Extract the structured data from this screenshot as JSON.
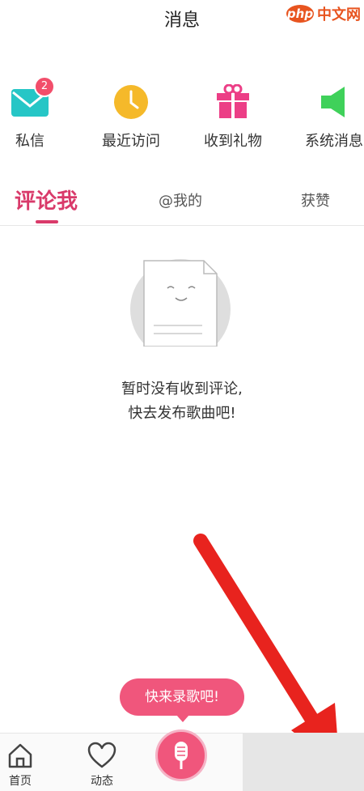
{
  "watermark": {
    "logo": "php",
    "text": "中文网"
  },
  "title": "消息",
  "quick": [
    {
      "label": "私信",
      "icon": "mail-icon",
      "badge": "2",
      "color": "#26c6c6"
    },
    {
      "label": "最近访问",
      "icon": "clock-icon",
      "color": "#f5b92a"
    },
    {
      "label": "收到礼物",
      "icon": "gift-icon",
      "color": "#ec3e86"
    },
    {
      "label": "系统消息",
      "icon": "speaker-icon",
      "color": "#3fd15a"
    }
  ],
  "tabs": [
    {
      "label": "评论我",
      "active": true
    },
    {
      "label": "@我的"
    },
    {
      "label": "获赞"
    }
  ],
  "empty": {
    "line1": "暂时没有收到评论,",
    "line2": "快去发布歌曲吧!"
  },
  "tooltip": "快来录歌吧!",
  "nav": [
    {
      "label": "首页",
      "icon": "home-icon"
    },
    {
      "label": "动态",
      "icon": "heart-icon"
    },
    {
      "label": "",
      "icon": "microphone-icon"
    }
  ],
  "colors": {
    "accent": "#d93a6a",
    "tooltip": "#f0567c",
    "arrow": "#e8231e"
  }
}
